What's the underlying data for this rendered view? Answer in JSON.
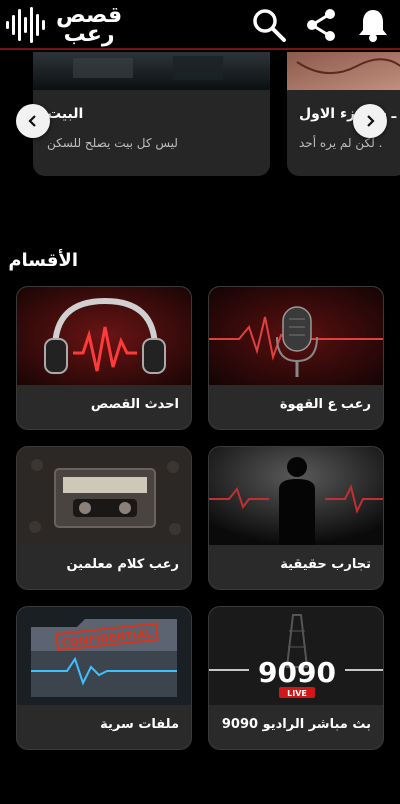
{
  "header": {
    "logo_line1": "قصص",
    "logo_line2": "رعب",
    "icons": [
      "search-icon",
      "share-icon",
      "bell-icon"
    ],
    "accent": "#7a1212"
  },
  "carousel": {
    "slides": [
      {
        "title": "البيت",
        "subtitle": "ليس كل بيت يصلح للسكن"
      },
      {
        "title": "ـ - الجزء الاول",
        "subtitle": ". لكن لم يره أحد"
      }
    ]
  },
  "categories": {
    "title": "الأقسام",
    "items": [
      {
        "label": "رعب ع القهوة",
        "image": "microphone"
      },
      {
        "label": "احدث القصص",
        "image": "headphones"
      },
      {
        "label": "تجارب حقيقية",
        "image": "silhouette"
      },
      {
        "label": "رعب كلام معلمين",
        "image": "cassette"
      },
      {
        "label": "بث مباشر الراديو 9090",
        "image": "radio-9090"
      },
      {
        "label": "ملفات سرية",
        "image": "confidential-folder"
      }
    ],
    "radio_logo_text": "9090",
    "radio_live_text": "LIVE",
    "folder_stamp_text": "CONFIDENTIAL"
  }
}
